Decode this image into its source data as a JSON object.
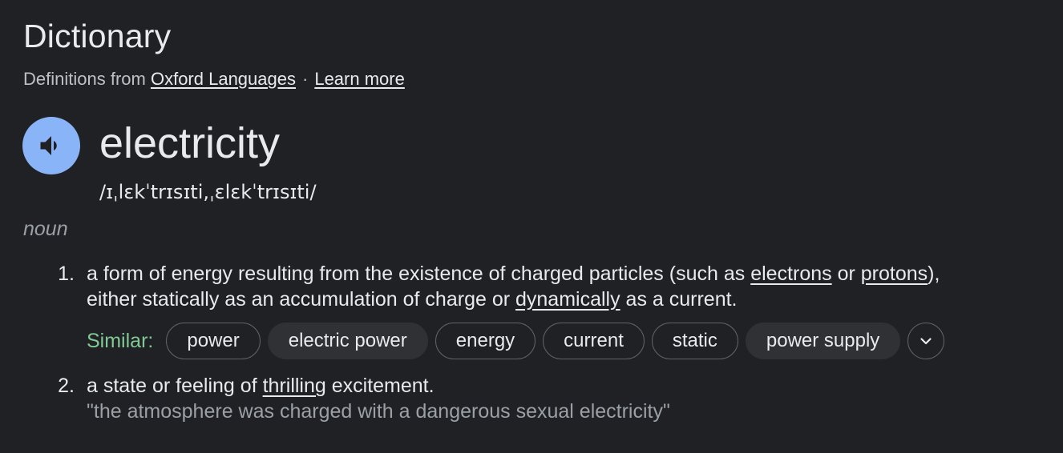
{
  "header": {
    "title": "Dictionary",
    "source_prefix": "Definitions from",
    "source_link": "Oxford Languages",
    "separator": "·",
    "learn_more": "Learn more"
  },
  "entry": {
    "word": "electricity",
    "phonetic": "/ɪˌlɛkˈtrɪsɪti,ˌɛlɛkˈtrɪsɪti/",
    "part_of_speech": "noun"
  },
  "definitions": [
    {
      "number": "1.",
      "line1_a": "a form of energy resulting from the existence of charged particles (such as ",
      "link1": "electrons",
      "line1_b": " or ",
      "link2": "protons",
      "line1_c": "),",
      "line2_a": "either statically as an accumulation of charge or ",
      "link3": "dynamically",
      "line2_b": " as a current."
    },
    {
      "number": "2.",
      "text_a": "a state or feeling of ",
      "link1": "thrilling",
      "text_b": " excitement.",
      "example": "\"the atmosphere was charged with a dangerous sexual electricity\""
    }
  ],
  "similar": {
    "label": "Similar:",
    "chips": [
      "power",
      "electric power",
      "energy",
      "current",
      "static",
      "power supply"
    ]
  },
  "icons": {
    "speaker": "speaker-icon",
    "expand": "chevron-down-icon"
  },
  "colors": {
    "background": "#202124",
    "accent_blue": "#8ab4f8",
    "similar_green": "#81c995"
  }
}
